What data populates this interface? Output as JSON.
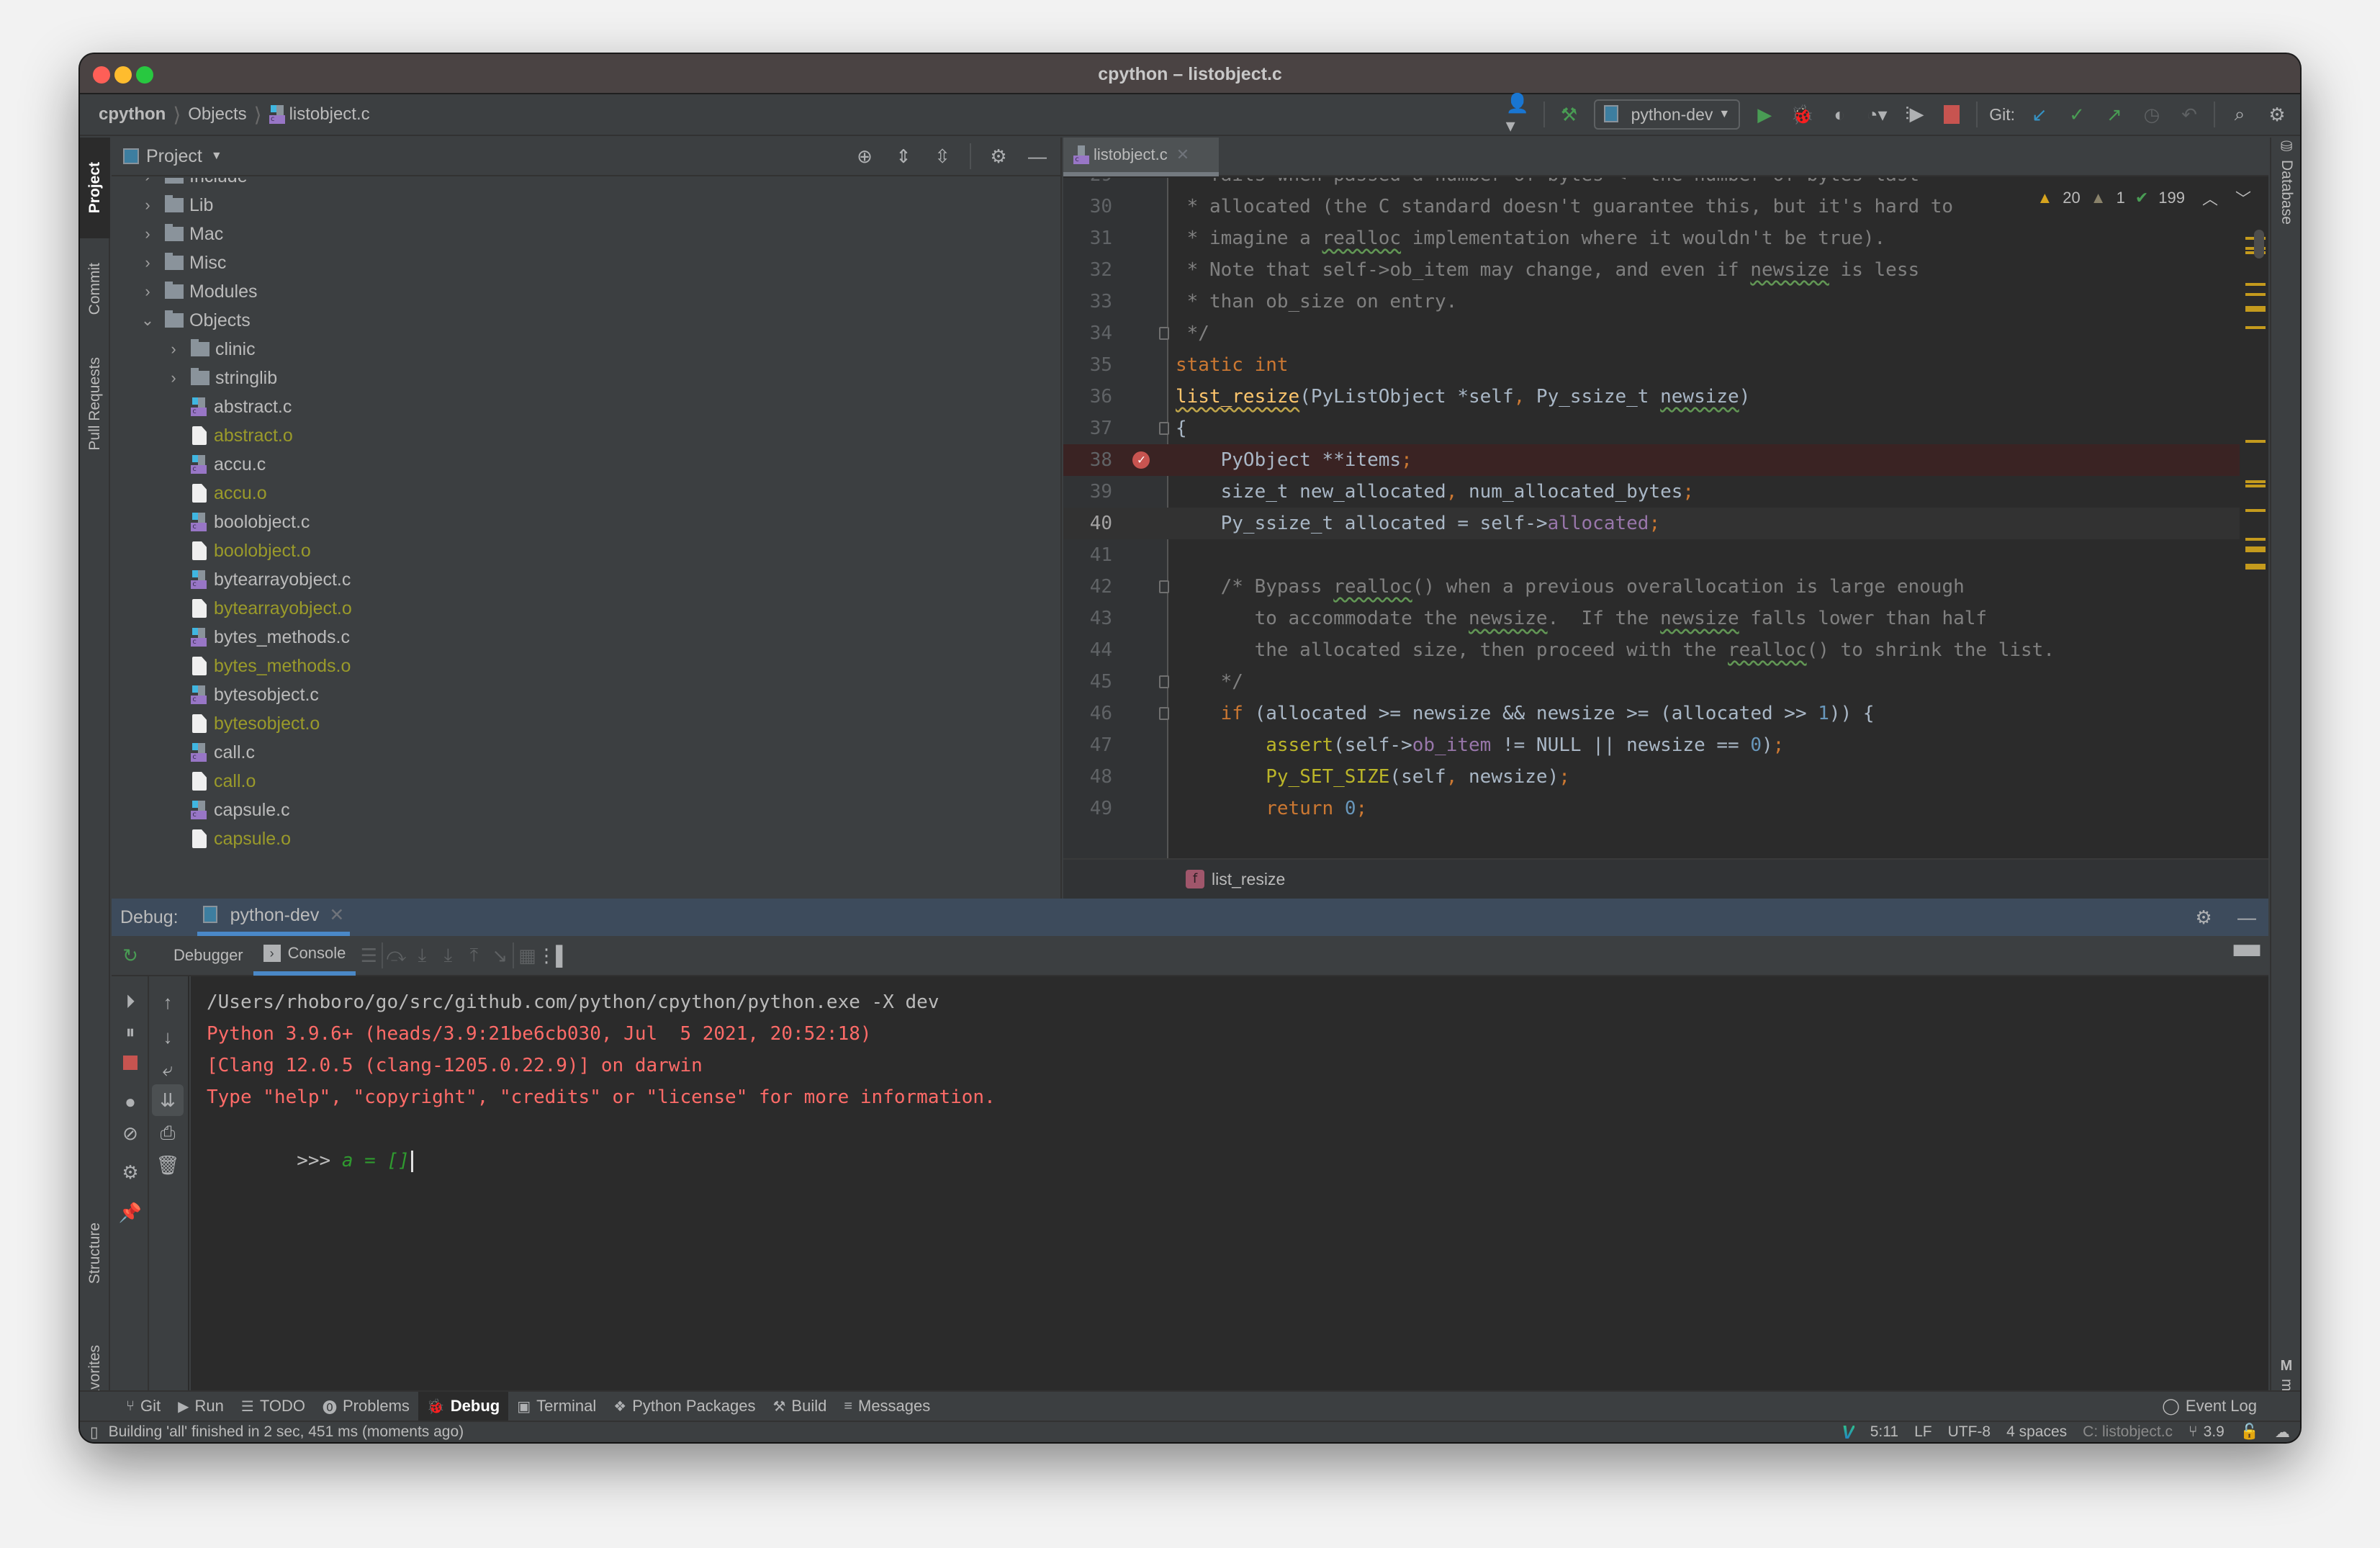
{
  "window": {
    "title": "cpython – listobject.c"
  },
  "breadcrumb": [
    "cpython",
    "Objects",
    "listobject.c"
  ],
  "toolbar": {
    "run_config": "python-dev",
    "git_label": "Git:",
    "icons": [
      "user-icon",
      "build-hammer-icon",
      "run-icon",
      "debug-icon",
      "coverage-icon",
      "profile-icon",
      "attach-icon",
      "stop-icon",
      "git-update-icon",
      "git-commit-icon",
      "git-push-icon",
      "history-icon",
      "rollback-icon",
      "search-icon",
      "settings-icon"
    ]
  },
  "left_stripe": {
    "tabs": [
      "Project",
      "Commit",
      "Pull Requests",
      "Structure",
      "Favorites"
    ]
  },
  "right_stripe": {
    "tabs": [
      "Database",
      "make"
    ]
  },
  "project": {
    "title": "Project",
    "tree": [
      {
        "name": "Include",
        "type": "folder",
        "depth": 0,
        "expanded": false
      },
      {
        "name": "Lib",
        "type": "folder",
        "depth": 0,
        "expanded": false
      },
      {
        "name": "Mac",
        "type": "folder",
        "depth": 0,
        "expanded": false
      },
      {
        "name": "Misc",
        "type": "folder",
        "depth": 0,
        "expanded": false
      },
      {
        "name": "Modules",
        "type": "folder",
        "depth": 0,
        "expanded": false
      },
      {
        "name": "Objects",
        "type": "folder",
        "depth": 0,
        "expanded": true
      },
      {
        "name": "clinic",
        "type": "folder",
        "depth": 1,
        "expanded": false
      },
      {
        "name": "stringlib",
        "type": "folder",
        "depth": 1,
        "expanded": false
      },
      {
        "name": "abstract.c",
        "type": "c",
        "depth": 1
      },
      {
        "name": "abstract.o",
        "type": "o",
        "depth": 1
      },
      {
        "name": "accu.c",
        "type": "c",
        "depth": 1
      },
      {
        "name": "accu.o",
        "type": "o",
        "depth": 1
      },
      {
        "name": "boolobject.c",
        "type": "c",
        "depth": 1
      },
      {
        "name": "boolobject.o",
        "type": "o",
        "depth": 1
      },
      {
        "name": "bytearrayobject.c",
        "type": "c",
        "depth": 1
      },
      {
        "name": "bytearrayobject.o",
        "type": "o",
        "depth": 1
      },
      {
        "name": "bytes_methods.c",
        "type": "c",
        "depth": 1
      },
      {
        "name": "bytes_methods.o",
        "type": "o",
        "depth": 1
      },
      {
        "name": "bytesobject.c",
        "type": "c",
        "depth": 1
      },
      {
        "name": "bytesobject.o",
        "type": "o",
        "depth": 1
      },
      {
        "name": "call.c",
        "type": "c",
        "depth": 1
      },
      {
        "name": "call.o",
        "type": "o",
        "depth": 1
      },
      {
        "name": "capsule.c",
        "type": "c",
        "depth": 1
      },
      {
        "name": "capsule.o",
        "type": "o",
        "depth": 1
      }
    ]
  },
  "editor": {
    "tab": "listobject.c",
    "inspections": {
      "warnings": "20",
      "weak_warnings": "1",
      "typos": "199"
    },
    "breadcrumb_fn": "list_resize",
    "breakpoint_line": 38,
    "current_line": 40,
    "lines": [
      {
        "n": "29",
        "html": "<span class='cm'> * fails when passed a number of bytes &lt;= the number of bytes last</span>"
      },
      {
        "n": "30",
        "html": "<span class='cm'> * allocated (the C standard doesn't guarantee this, but it's hard to</span>"
      },
      {
        "n": "31",
        "html": "<span class='cm'> * imagine a <span class='squig'>realloc</span> implementation where it wouldn't be true).</span>"
      },
      {
        "n": "32",
        "html": "<span class='cm'> * Note that self-&gt;ob_item may change, and even if <span class='squig'>newsize</span> is less</span>"
      },
      {
        "n": "33",
        "html": "<span class='cm'> * than ob_size on entry.</span>"
      },
      {
        "n": "34",
        "html": "<span class='cm'> */</span>"
      },
      {
        "n": "35",
        "html": "<span class='kw'>static int</span>"
      },
      {
        "n": "36",
        "html": "<span class='fn squig-y'>list_resize</span>(PyListObject *self<span class='kw'>,</span> Py_ssize_t <span class='squig'>newsize</span>)"
      },
      {
        "n": "37",
        "html": "{"
      },
      {
        "n": "38",
        "html": "    PyObject **items<span class='kw'>;</span>"
      },
      {
        "n": "39",
        "html": "    size_t new_allocated<span class='kw'>,</span> num_allocated_bytes<span class='kw'>;</span>"
      },
      {
        "n": "40",
        "html": "    Py_ssize_t allocated = self-&gt;<span class='field'>allocated</span><span class='kw'>;</span>"
      },
      {
        "n": "41",
        "html": ""
      },
      {
        "n": "42",
        "html": "    <span class='cm'>/* Bypass <span class='squig'>realloc</span>() when a previous overallocation is large enough</span>"
      },
      {
        "n": "43",
        "html": "<span class='cm'>       to accommodate the <span class='squig'>newsize</span>.  If the <span class='squig'>newsize</span> falls lower than half</span>"
      },
      {
        "n": "44",
        "html": "<span class='cm'>       the allocated size, then proceed with the <span class='squig'>realloc</span>() to shrink the list.</span>"
      },
      {
        "n": "45",
        "html": "<span class='cm'>    */</span>"
      },
      {
        "n": "46",
        "html": "    <span class='kw'>if</span> (allocated &gt;= newsize &amp;&amp; newsize &gt;= (allocated &gt;&gt; <span class='num'>1</span>)) {"
      },
      {
        "n": "47",
        "html": "        <span class='macro'>assert</span>(self-&gt;<span class='field'>ob_item</span> != NULL || newsize == <span class='num'>0</span>)<span class='kw'>;</span>"
      },
      {
        "n": "48",
        "html": "        <span class='macro'>Py_SET_SIZE</span>(self<span class='kw'>,</span> newsize)<span class='kw'>;</span>"
      },
      {
        "n": "49",
        "html": "        <span class='kw'>return</span> <span class='num'>0</span><span class='kw'>;</span>"
      }
    ]
  },
  "debug": {
    "label": "Debug:",
    "session": "python-dev",
    "subtabs": [
      "Debugger",
      "Console"
    ],
    "active_subtab": "Console",
    "console": {
      "command": "/Users/rhoboro/go/src/github.com/python/cpython/python.exe -X dev",
      "output": [
        "Python 3.9.6+ (heads/3.9:21be6cb030, Jul  5 2021, 20:52:18)",
        "[Clang 12.0.5 (clang-1205.0.22.9)] on darwin",
        "Type \"help\", \"copyright\", \"credits\" or \"license\" for more information."
      ],
      "prompt": ">>> ",
      "input": "a = []"
    }
  },
  "tool_tabs": [
    {
      "label": "Git",
      "icon": "git-icon"
    },
    {
      "label": "Run",
      "icon": "run-icon"
    },
    {
      "label": "TODO",
      "icon": "todo-icon"
    },
    {
      "label": "Problems",
      "icon": "problems-icon"
    },
    {
      "label": "Debug",
      "icon": "debug-icon",
      "active": true
    },
    {
      "label": "Terminal",
      "icon": "terminal-icon"
    },
    {
      "label": "Python Packages",
      "icon": "packages-icon"
    },
    {
      "label": "Build",
      "icon": "build-icon"
    },
    {
      "label": "Messages",
      "icon": "messages-icon"
    }
  ],
  "event_log": "Event Log",
  "status": {
    "message": "Building 'all' finished in 2 sec, 451 ms (moments ago)",
    "position": "5:11",
    "line_sep": "LF",
    "encoding": "UTF-8",
    "indent": "4 spaces",
    "context": "C: listobject.c",
    "branch": "3.9"
  }
}
